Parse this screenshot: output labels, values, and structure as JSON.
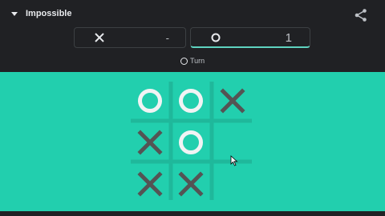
{
  "mode": {
    "label": "Impossible",
    "icon": "caret-down-icon"
  },
  "share": {
    "icon": "share-icon"
  },
  "scores": {
    "x": {
      "symbol": "X",
      "value": "-"
    },
    "o": {
      "symbol": "O",
      "value": "1"
    }
  },
  "turn": {
    "label": "Turn",
    "symbol": "O"
  },
  "board": {
    "cells": [
      [
        "O",
        "O",
        "X"
      ],
      [
        "X",
        "O",
        ""
      ],
      [
        "X",
        "X",
        ""
      ]
    ]
  },
  "colors": {
    "board_bg": "#22cfae",
    "o_mark": "#f1f3f4",
    "x_mark": "#545454",
    "grid_line": "#1aa38b"
  }
}
